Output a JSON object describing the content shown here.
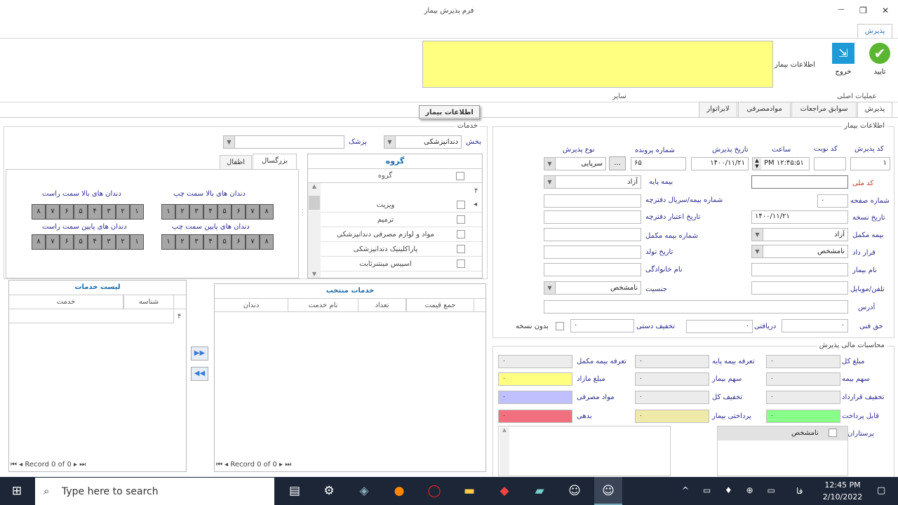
{
  "window": {
    "title": "فرم پذیرش بیمار",
    "minimize": "—",
    "maximize": "❐",
    "close": "✕"
  },
  "ribbon": {
    "tab": "پذیرش",
    "confirm": "تایید",
    "exit": "خروج",
    "group_main": "عملیات اصلی",
    "patient_info_label": "اطلاعات بیمار",
    "group_other": "سایر",
    "tooltip": "اطلاعات بیمار"
  },
  "tabs": [
    "پذیرش",
    "سوابق مراجعات",
    "موادمصرفی",
    "لابراتوار"
  ],
  "patient": {
    "title": "اطلاعات بیمار",
    "admit_code_l": "کد پذیرش",
    "admit_code": "١",
    "turn_code_l": "کد نوبت",
    "turn_code": "",
    "time_l": "ساعت",
    "time": "PM ۱۲:۴۵:۵۱",
    "admit_date_l": "تاریخ پذیرش",
    "admit_date": "۱۴۰۰/۱۱/۲۱",
    "file_no_l": "شماره پرونده",
    "file_no": "۶۵",
    "browse": "...",
    "admit_type_l": "نوع پذیرش",
    "admit_type": "سرپایی",
    "national_code_l": "کد ملی",
    "national_code": "",
    "base_ins_l": "بیمه پایه",
    "base_ins": "آزاد",
    "page_no_l": "شماره صفحه",
    "page_no": "۰",
    "ins_serial_l": "شماره بیمه/سریال دفترچه",
    "rx_date_l": "تاریخ نسخه",
    "rx_date": "۱۴۰۰/۱۱/۲۱",
    "booklet_valid_l": "تاریخ اعتبار دفترچه",
    "supp_ins_l": "بیمه مکمل",
    "supp_ins": "آزاد",
    "supp_ins_no_l": "شماره بیمه مکمل",
    "contract_l": "قرار داد",
    "contract": "نامشخص",
    "birth_l": "تاریخ تولد",
    "name_l": "نام بیمار",
    "family_l": "نام خانوادگی",
    "phone_l": "تلفن/موبایل",
    "gender_l": "جنسیت",
    "gender": "نامشخص",
    "address_l": "آدرس",
    "tech_fee_l": "حق فنی",
    "tech_fee": "۰",
    "received_l": "دریافتی",
    "received": "۰",
    "manual_disc_l": "تخفیف دستی",
    "manual_disc": "۰",
    "no_rx_l": "بدون نسخه"
  },
  "finance": {
    "title": "محاسبات مالی پذیرش",
    "rows": [
      [
        {
          "l": "مبلغ کل",
          "v": "۰"
        },
        {
          "l": "تعرفه بیمه پایه",
          "v": "۰"
        },
        {
          "l": "تعرفه بیمه مکمل",
          "v": "۰"
        }
      ],
      [
        {
          "l": "سهم بیمه",
          "v": "۰"
        },
        {
          "l": "سهم بیمار",
          "v": "۰"
        },
        {
          "l": "مبلغ مازاد",
          "v": "۰"
        }
      ],
      [
        {
          "l": "تخفیف قرارداد",
          "v": "۰"
        },
        {
          "l": "تخفیف کل",
          "v": "۰"
        },
        {
          "l": "مواد مصرفی",
          "v": "۰"
        }
      ],
      [
        {
          "l": "قابل پرداخت",
          "v": "۰"
        },
        {
          "l": "پرداختی بیمار",
          "v": "۰"
        },
        {
          "l": "بدهی",
          "v": "۰"
        }
      ]
    ],
    "nurses_l": "پرستاران",
    "nurse": "نامشخص",
    "colors": {
      "excess": "#ffff80",
      "materials": "#c0c0ff",
      "payable": "#88ff88",
      "paid": "#f0eaa8",
      "debt": "#f07080"
    }
  },
  "services": {
    "title": "خدمات",
    "dept_l": "بخش",
    "dept": "دندانپزشکی",
    "doctor_l": "پزشک",
    "group_title": "گروه",
    "group_col": "گروه",
    "new_row": "۴",
    "groups": [
      "ویزیت",
      "ترمیم",
      "مواد و لوازم مصرفی دندانپزشکی",
      "پاراکلینیک دندانپزشکی",
      "اسپیس مینتنرثابت"
    ],
    "tab_adult": "بزرگسال",
    "tab_child": "اطفال",
    "upper_left": "دندان های بالا سمت چپ",
    "upper_right": "دندان های بالا سمت راست",
    "lower_left": "دندان های پایین سمت چپ",
    "lower_right": "دندان های پایین سمت راست",
    "teeth_left": [
      "۱",
      "۲",
      "۳",
      "۴",
      "۵",
      "۶",
      "۷",
      "۸"
    ],
    "teeth_right": [
      "۸",
      "۷",
      "۶",
      "۵",
      "۴",
      "۳",
      "۲",
      "۱"
    ]
  },
  "service_list": {
    "title": "لیست خدمات",
    "cols": [
      "شناسه",
      "خدمت"
    ],
    "new_row": "۴",
    "record": "Record 0 of 0"
  },
  "selected": {
    "title": "خدمات منتخب",
    "cols": [
      "جمع قیمت",
      "تعداد",
      "نام خدمت",
      "دندان"
    ],
    "record": "Record 0 of 0"
  },
  "taskbar": {
    "search": "Type here to search",
    "lang": "فا",
    "time": "12:45 PM",
    "date": "2/10/2022"
  }
}
